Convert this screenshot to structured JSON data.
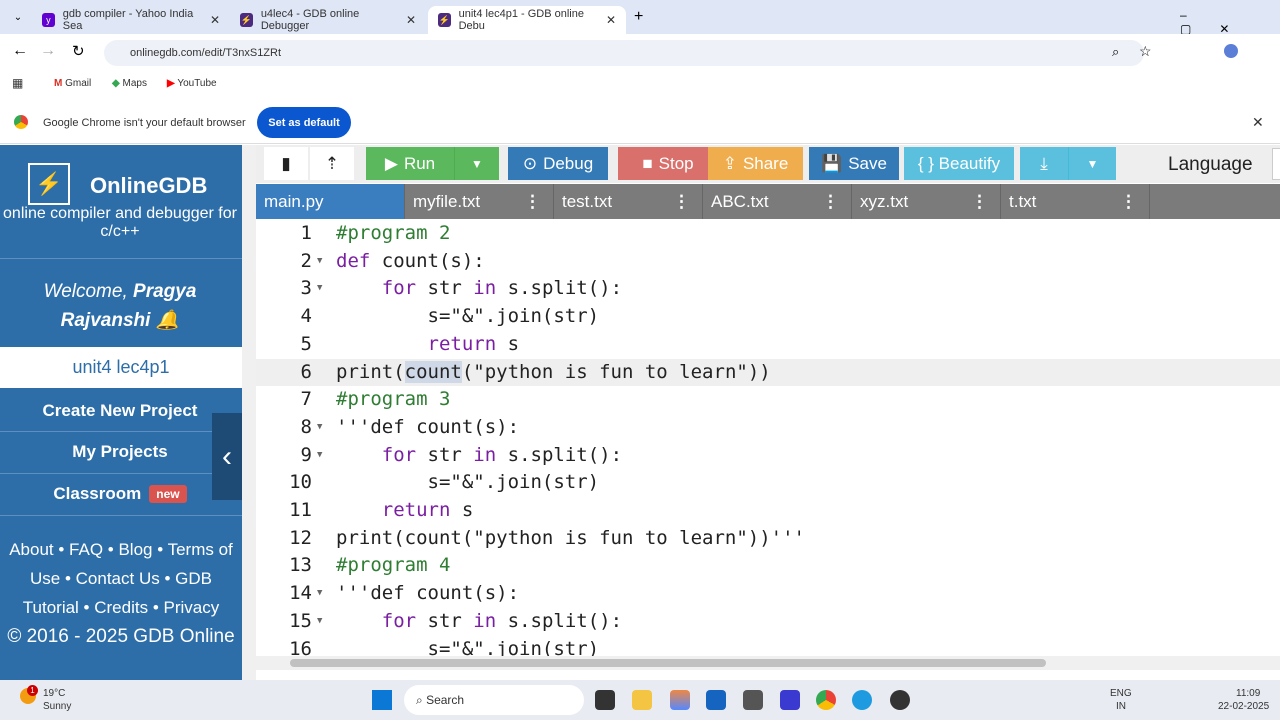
{
  "browser": {
    "tabs": [
      {
        "title": "gdb compiler - Yahoo India Sea"
      },
      {
        "title": "u4lec4 - GDB online Debugger"
      },
      {
        "title": "unit4 lec4p1 - GDB online Debu"
      }
    ],
    "url": "onlinegdb.com/edit/T3nxS1ZRt",
    "bookmarks": [
      "Gmail",
      "Maps",
      "YouTube"
    ],
    "infobar": {
      "message": "Google Chrome isn't your default browser",
      "button": "Set as default"
    }
  },
  "sidebar": {
    "brand": "OnlineGDB",
    "tagline": "online compiler and debugger for c/c++",
    "welcome": "Welcome,",
    "user": "Pragya Rajvanshi",
    "project": "unit4 lec4p1",
    "buttons": [
      "Create New Project",
      "My Projects",
      "Classroom"
    ],
    "new_badge": "new",
    "footer": [
      "About",
      "FAQ",
      "Blog",
      "Terms of Use",
      "Contact Us",
      "GDB Tutorial",
      "Credits",
      "Privacy"
    ],
    "copyright": "© 2016 - 2025 GDB Online"
  },
  "toolbar": {
    "run": "Run",
    "debug": "Debug",
    "stop": "Stop",
    "share": "Share",
    "save": "Save",
    "beautify": "{ } Beautify",
    "language": "Language"
  },
  "files": [
    "main.py",
    "myfile.txt",
    "test.txt",
    "ABC.txt",
    "xyz.txt",
    "t.txt"
  ],
  "code": [
    {
      "n": "1",
      "t": [
        [
          "#program 2",
          "c"
        ]
      ]
    },
    {
      "n": "2",
      "f": true,
      "t": [
        [
          "def",
          "k"
        ],
        [
          " count(s):",
          ""
        ]
      ]
    },
    {
      "n": "3",
      "f": true,
      "t": [
        [
          "    ",
          ""
        ],
        [
          "for",
          "k"
        ],
        [
          " str ",
          ""
        ],
        [
          "in",
          "k"
        ],
        [
          " s.split():",
          ""
        ]
      ]
    },
    {
      "n": "4",
      "t": [
        [
          "        s=\"&\".join(str)",
          ""
        ]
      ]
    },
    {
      "n": "5",
      "t": [
        [
          "        ",
          ""
        ],
        [
          "return",
          "k"
        ],
        [
          " s",
          ""
        ]
      ]
    },
    {
      "n": "6",
      "hl": true,
      "t": [
        [
          "print(",
          ""
        ],
        [
          "count",
          "sel"
        ],
        [
          "(\"python is fun to learn\"))",
          ""
        ]
      ]
    },
    {
      "n": "7",
      "t": [
        [
          "#program 3",
          "c"
        ]
      ]
    },
    {
      "n": "8",
      "f": true,
      "t": [
        [
          "'''def count(s):",
          ""
        ]
      ]
    },
    {
      "n": "9",
      "f": true,
      "t": [
        [
          "    ",
          ""
        ],
        [
          "for",
          "k"
        ],
        [
          " str ",
          ""
        ],
        [
          "in",
          "k"
        ],
        [
          " s.split():",
          ""
        ]
      ]
    },
    {
      "n": "10",
      "t": [
        [
          "        s=\"&\".join(str)",
          ""
        ]
      ]
    },
    {
      "n": "11",
      "t": [
        [
          "    ",
          ""
        ],
        [
          "return",
          "k"
        ],
        [
          " s",
          ""
        ]
      ]
    },
    {
      "n": "12",
      "t": [
        [
          "print(count(\"python is fun to learn\"))'''",
          ""
        ]
      ]
    },
    {
      "n": "13",
      "t": [
        [
          "#program 4",
          "c"
        ]
      ]
    },
    {
      "n": "14",
      "f": true,
      "t": [
        [
          "'''def count(s):",
          ""
        ]
      ]
    },
    {
      "n": "15",
      "f": true,
      "t": [
        [
          "    ",
          ""
        ],
        [
          "for",
          "k"
        ],
        [
          " str ",
          ""
        ],
        [
          "in",
          "k"
        ],
        [
          " s.split():",
          ""
        ]
      ]
    },
    {
      "n": "16",
      "t": [
        [
          "        s=\"&\".join(str)",
          ""
        ]
      ]
    }
  ],
  "taskbar": {
    "temp": "19°C",
    "weather": "Sunny",
    "search": "Search",
    "lang1": "ENG",
    "lang2": "IN",
    "time": "11:09",
    "date": "22-02-2025",
    "notif": "1"
  }
}
